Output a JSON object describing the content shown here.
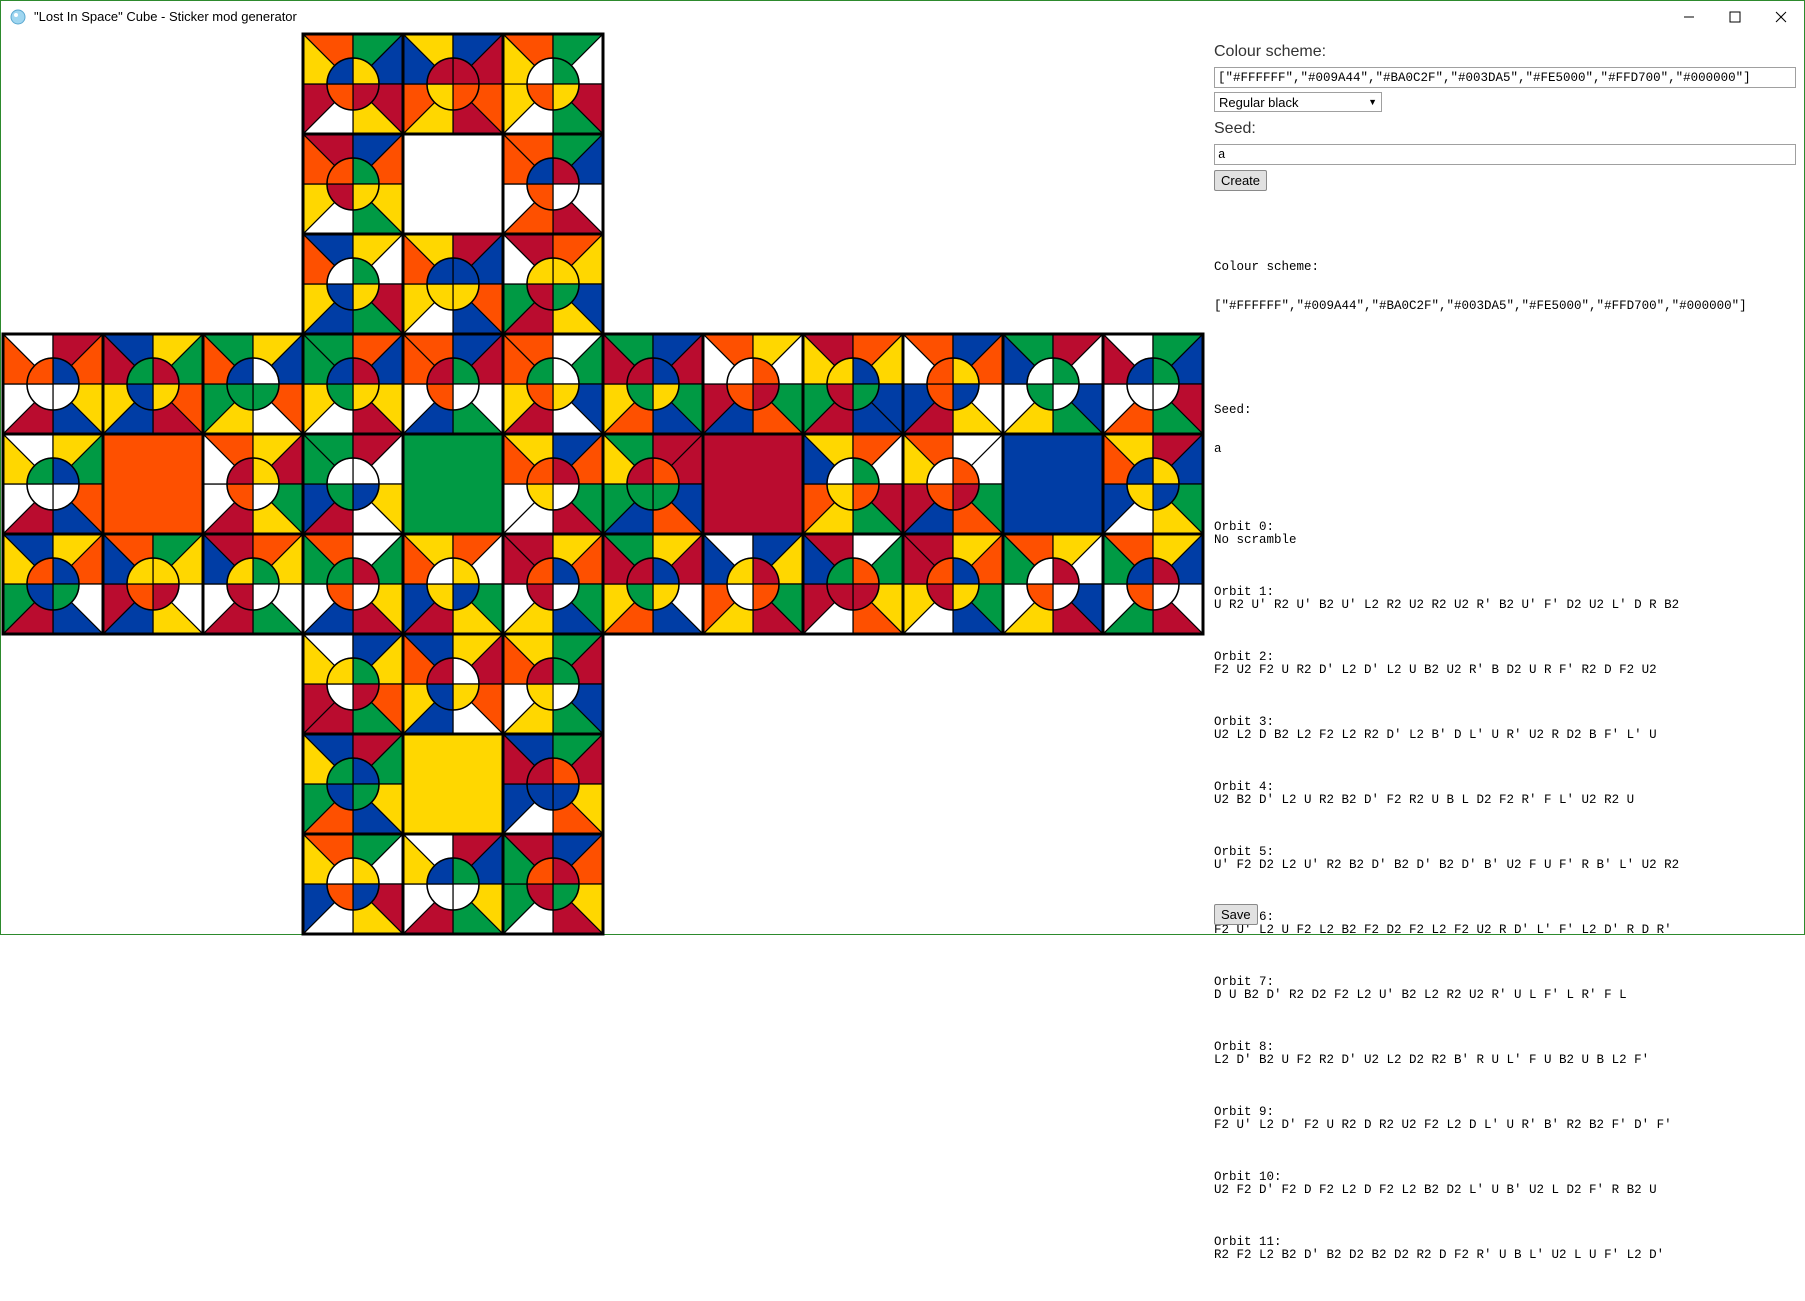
{
  "window": {
    "title": "\"Lost In Space\" Cube - Sticker mod generator",
    "minimize_glyph": "—",
    "maximize_glyph": "☐",
    "close_glyph": "✕"
  },
  "colors": {
    "W": "#FFFFFF",
    "G": "#009A44",
    "R": "#BA0C2F",
    "B": "#003DA5",
    "O": "#FE5000",
    "Y": "#FFD700",
    "K": "#000000"
  },
  "form": {
    "colour_label": "Colour scheme:",
    "colour_value": "[\"#FFFFFF\",\"#009A44\",\"#BA0C2F\",\"#003DA5\",\"#FE5000\",\"#FFD700\",\"#000000\"]",
    "preset_selected": "Regular black",
    "seed_label": "Seed:",
    "seed_value": "a",
    "create_label": "Create",
    "save_label": "Save"
  },
  "output": {
    "colour_heading": "Colour scheme:",
    "colour_value": "[\"#FFFFFF\",\"#009A44\",\"#BA0C2F\",\"#003DA5\",\"#FE5000\",\"#FFD700\",\"#000000\"]",
    "seed_heading": "Seed:",
    "seed_value": "a",
    "orbits": [
      {
        "label": "Orbit 0:",
        "value": "No scramble"
      },
      {
        "label": "Orbit 1:",
        "value": "U R2 U' R2 U' B2 U' L2 R2 U2 R2 U2 R' B2 U' F' D2 U2 L' D R B2"
      },
      {
        "label": "Orbit 2:",
        "value": "F2 U2 F2 U R2 D' L2 D' L2 U B2 U2 R' B D2 U R F' R2 D F2 U2"
      },
      {
        "label": "Orbit 3:",
        "value": "U2 L2 D B2 L2 F2 L2 R2 D' L2 B' D L' U R' U2 R D2 B F' L' U"
      },
      {
        "label": "Orbit 4:",
        "value": "U2 B2 D' L2 U R2 B2 D' F2 R2 U B L D2 F2 R' F L' U2 R2 U"
      },
      {
        "label": "Orbit 5:",
        "value": "U' F2 D2 L2 U' R2 B2 D' B2 D' B2 D' B' U2 F U F' R B' L' U2 R2"
      },
      {
        "label": "Orbit 6:",
        "value": "F2 U' L2 U F2 L2 B2 F2 D2 F2 L2 F2 U2 R D' L' F' L2 D' R D R'"
      },
      {
        "label": "Orbit 7:",
        "value": "D U B2 D' R2 D2 F2 L2 U' B2 L2 R2 U2 R' U L F' L R' F L"
      },
      {
        "label": "Orbit 8:",
        "value": "L2 D' B2 U F2 R2 D' U2 L2 D2 R2 B' R U L' F U B2 U B L2 F'"
      },
      {
        "label": "Orbit 9:",
        "value": "F2 U' L2 D' F2 U R2 D R2 U2 F2 L2 D L' U R' B' R2 B2 F' D' F'"
      },
      {
        "label": "Orbit 10:",
        "value": "U2 F2 D' F2 D F2 L2 D F2 L2 B2 D2 L' U B' U2 L D2 F' R B2 U"
      },
      {
        "label": "Orbit 11:",
        "value": "R2 F2 L2 B2 D' B2 D2 B2 D2 R2 D F2 R' U B L' U2 L U F' L2 D'"
      }
    ]
  },
  "cube_net": {
    "sticker_codes": [
      "W",
      "G",
      "R",
      "B",
      "O",
      "Y"
    ],
    "stickers": [
      {
        "col": 3,
        "row": 0,
        "code": "OGBRYWRY"
      },
      {
        "col": 4,
        "row": 0,
        "code": "YBRORYOB"
      },
      {
        "col": 5,
        "row": 0,
        "code": "OGWRGWYY"
      },
      {
        "col": 3,
        "row": 1,
        "code": "RBOYGWYO"
      },
      {
        "col": 4,
        "row": 1,
        "center": "W"
      },
      {
        "col": 5,
        "row": 1,
        "code": "OGBWROWO"
      },
      {
        "col": 3,
        "row": 2,
        "code": "BYWRGBYO"
      },
      {
        "col": 4,
        "row": 2,
        "code": "YRBOBWYO"
      },
      {
        "col": 5,
        "row": 2,
        "code": "ROYBYRGW"
      },
      {
        "col": 0,
        "row": 3,
        "code": "WROYBRWO"
      },
      {
        "col": 1,
        "row": 3,
        "code": "BYGORBYR"
      },
      {
        "col": 2,
        "row": 3,
        "code": "GYBOWYGO"
      },
      {
        "col": 3,
        "row": 3,
        "code": "GOBYRWYG"
      },
      {
        "col": 4,
        "row": 3,
        "code": "OBRWGBWO"
      },
      {
        "col": 5,
        "row": 3,
        "code": "OWGBWRYO"
      },
      {
        "col": 6,
        "row": 3,
        "code": "GBRGBOYR"
      },
      {
        "col": 7,
        "row": 3,
        "code": "OYWGOBRW"
      },
      {
        "col": 8,
        "row": 3,
        "code": "ROYBBRGY"
      },
      {
        "col": 9,
        "row": 3,
        "code": "OBOWYRBW"
      },
      {
        "col": 10,
        "row": 3,
        "code": "GRWBGYWB"
      },
      {
        "col": 11,
        "row": 3,
        "code": "WGBRGOWR"
      },
      {
        "col": 0,
        "row": 4,
        "code": "WYGOBRWY"
      },
      {
        "col": 1,
        "row": 4,
        "center": "O"
      },
      {
        "col": 2,
        "row": 4,
        "code": "OYRGYRWW"
      },
      {
        "col": 3,
        "row": 4,
        "code": "GRWYWRBG"
      },
      {
        "col": 4,
        "row": 4,
        "center": "G"
      },
      {
        "col": 5,
        "row": 4,
        "code": "YBOGRWWO"
      },
      {
        "col": 6,
        "row": 4,
        "code": "GRRBOBGY"
      },
      {
        "col": 7,
        "row": 4,
        "center": "R"
      },
      {
        "col": 8,
        "row": 4,
        "code": "YOWRGYOB"
      },
      {
        "col": 9,
        "row": 4,
        "code": "OWWGOBRY"
      },
      {
        "col": 10,
        "row": 4,
        "center": "B"
      },
      {
        "col": 11,
        "row": 4,
        "code": "YRBGYWBO"
      },
      {
        "col": 0,
        "row": 5,
        "code": "BYOWBRGY"
      },
      {
        "col": 1,
        "row": 5,
        "code": "OGYWYBRB"
      },
      {
        "col": 2,
        "row": 5,
        "code": "ROYWGRWB"
      },
      {
        "col": 3,
        "row": 5,
        "code": "OWGYRBWG"
      },
      {
        "col": 4,
        "row": 5,
        "code": "YOWGYRBO"
      },
      {
        "col": 5,
        "row": 5,
        "code": "RYOGBYWR"
      },
      {
        "col": 6,
        "row": 5,
        "code": "GYRWBOYR"
      },
      {
        "col": 7,
        "row": 5,
        "code": "WBYGRYOB"
      },
      {
        "col": 8,
        "row": 5,
        "code": "RWGYOWRB"
      },
      {
        "col": 9,
        "row": 5,
        "code": "RYOGBWYR"
      },
      {
        "col": 10,
        "row": 5,
        "code": "OYWBRYWG"
      },
      {
        "col": 11,
        "row": 5,
        "code": "OYBWRGWG"
      },
      {
        "col": 3,
        "row": 6,
        "code": "WBYOGRRY"
      },
      {
        "col": 4,
        "row": 6,
        "code": "BYROWBYO"
      },
      {
        "col": 5,
        "row": 6,
        "code": "YGRBGYWO"
      },
      {
        "col": 3,
        "row": 7,
        "code": "BRGYBOGY"
      },
      {
        "col": 4,
        "row": 7,
        "center": "Y"
      },
      {
        "col": 5,
        "row": 7,
        "code": "BGRYOWBR"
      },
      {
        "col": 3,
        "row": 8,
        "code": "OGWRYWBY"
      },
      {
        "col": 4,
        "row": 8,
        "code": "WRBYGRWY"
      },
      {
        "col": 5,
        "row": 8,
        "code": "RBOYRWGG"
      }
    ]
  }
}
